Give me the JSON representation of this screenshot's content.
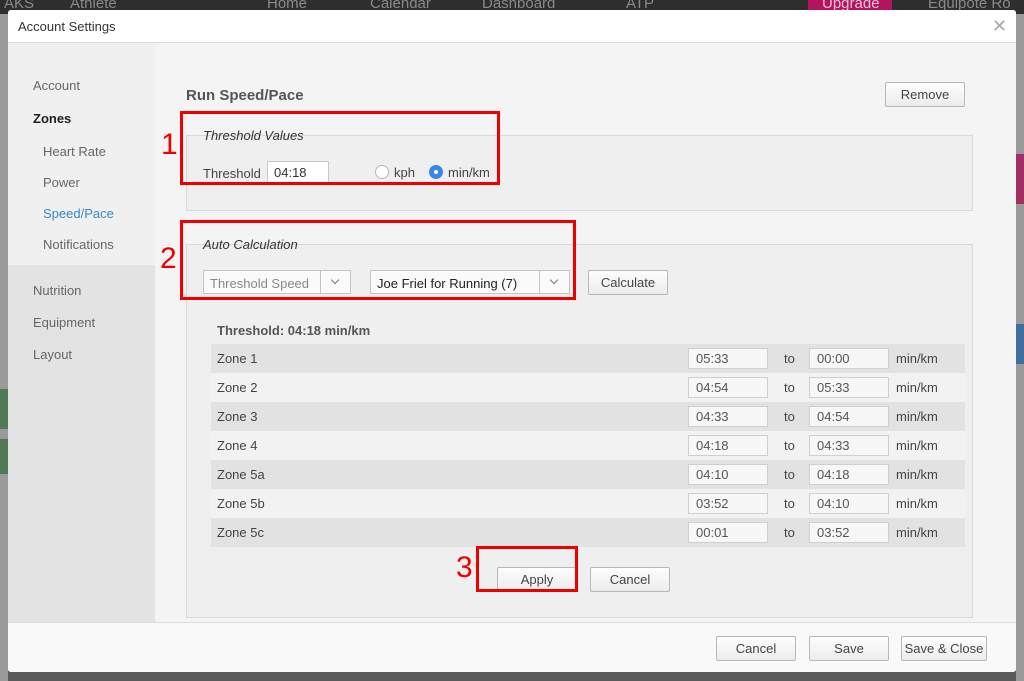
{
  "background": {
    "nav_left": "AKS",
    "nav_athlete": "Athlete",
    "nav_home": "Home",
    "nav_calendar": "Calendar",
    "nav_dashboard": "Dashboard",
    "nav_atp": "ATP",
    "nav_upgrade": "Upgrade",
    "nav_user": "Equipote Ro"
  },
  "modal": {
    "title": "Account Settings",
    "close_glyph": "✕"
  },
  "sidebar": {
    "account": "Account",
    "zones": "Zones",
    "heart_rate": "Heart Rate",
    "power": "Power",
    "speed_pace": "Speed/Pace",
    "notifications": "Notifications",
    "nutrition": "Nutrition",
    "equipment": "Equipment",
    "layout": "Layout"
  },
  "page": {
    "title": "Run Speed/Pace",
    "remove_label": "Remove"
  },
  "threshold": {
    "legend": "Threshold Values",
    "label": "Threshold",
    "value": "04:18",
    "unit_kph": "kph",
    "unit_minkm": "min/km",
    "selected_unit": "min/km"
  },
  "auto": {
    "legend": "Auto Calculation",
    "method_value": "Threshold Speed",
    "model_value": "Joe Friel for Running (7)",
    "calculate_label": "Calculate",
    "summary": "Threshold: 04:18 min/km"
  },
  "zones": [
    {
      "name": "Zone 1",
      "from": "05:33",
      "to": "00:00"
    },
    {
      "name": "Zone 2",
      "from": "04:54",
      "to": "05:33"
    },
    {
      "name": "Zone 3",
      "from": "04:33",
      "to": "04:54"
    },
    {
      "name": "Zone 4",
      "from": "04:18",
      "to": "04:33"
    },
    {
      "name": "Zone 5a",
      "from": "04:10",
      "to": "04:18"
    },
    {
      "name": "Zone 5b",
      "from": "03:52",
      "to": "04:10"
    },
    {
      "name": "Zone 5c",
      "from": "00:01",
      "to": "03:52"
    }
  ],
  "zone_to_label": "to",
  "zone_unit": "min/km",
  "actions": {
    "apply_label": "Apply",
    "cancel_label": "Cancel"
  },
  "footer": {
    "cancel_label": "Cancel",
    "save_label": "Save",
    "save_close_label": "Save & Close"
  },
  "annotations": {
    "n1": "1",
    "n2": "2",
    "n3": "3"
  },
  "colors": {
    "accent": "#3a86c6",
    "radio_selected": "#3a86f0",
    "annotation": "#ee0000",
    "upgrade": "#b2155e"
  }
}
